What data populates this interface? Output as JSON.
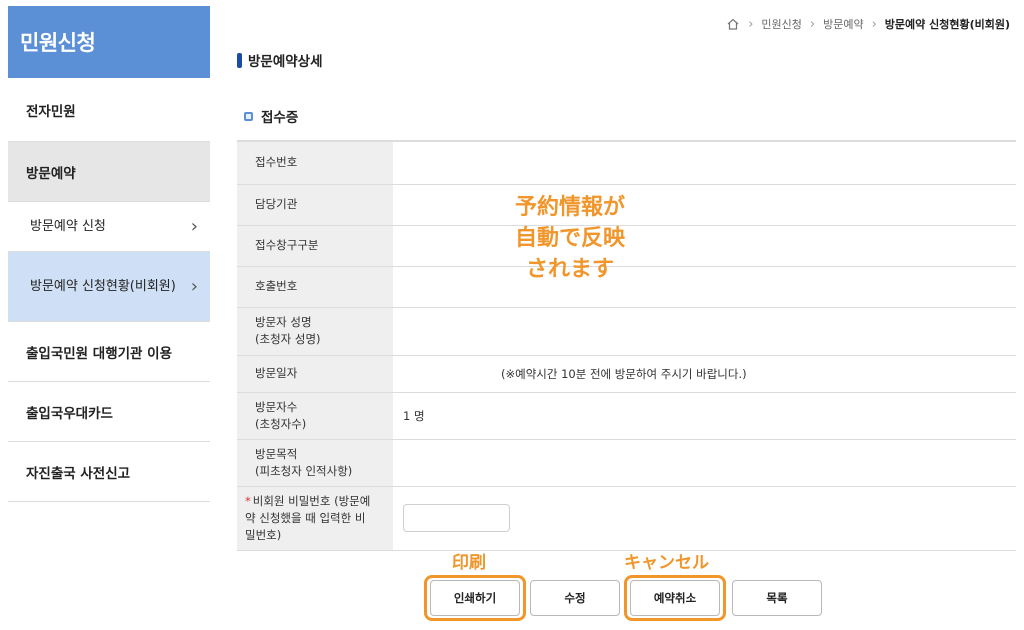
{
  "sidebar": {
    "title": "민원신청",
    "items": [
      {
        "label": "전자민원"
      },
      {
        "label": "방문예약"
      },
      {
        "label": "방문예약 신청"
      },
      {
        "label": "방문예약 신청현황(비회원)"
      },
      {
        "label": "출입국민원 대행기관 이용"
      },
      {
        "label": "출입국우대카드"
      },
      {
        "label": "자진출국 사전신고"
      }
    ]
  },
  "breadcrumb": {
    "items": [
      "민원신청",
      "방문예약"
    ],
    "current": "방문예약 신청현황(비회원)"
  },
  "page": {
    "title": "방문예약상세",
    "section": "접수증"
  },
  "table": {
    "rows": [
      {
        "label": "접수번호",
        "value": ""
      },
      {
        "label": "담당기관",
        "value": ""
      },
      {
        "label": "접수창구구분",
        "value": ""
      },
      {
        "label": "호출번호",
        "value": ""
      },
      {
        "label": "방문자 성명\n(초청자 성명)",
        "value": ""
      },
      {
        "label": "방문일자",
        "value": "(※예약시간 10분 전에 방문하여 주시기 바랍니다.)"
      },
      {
        "label": "방문자수\n(초청자수)",
        "value": "1 명"
      },
      {
        "label": "방문목적\n(피초청자 인적사항)",
        "value": ""
      },
      {
        "label": "비회원 비밀번호 (방문예약 신청했을 때 입력한 비밀번호)",
        "value": "",
        "required_mark": "*"
      }
    ]
  },
  "buttons": {
    "print": "인쇄하기",
    "edit": "수정",
    "cancel": "예약취소",
    "list": "목록"
  },
  "annotations": {
    "main_lines": [
      "予約情報が",
      "自動で反映",
      "されます"
    ],
    "print": "印刷",
    "cancel": "キャンセル"
  },
  "colors": {
    "sidebar_header": "#5b8fd6",
    "annotation": "#f0962b",
    "selected_sub": "#cfe0f6",
    "active_menu": "#e6e6e6"
  }
}
